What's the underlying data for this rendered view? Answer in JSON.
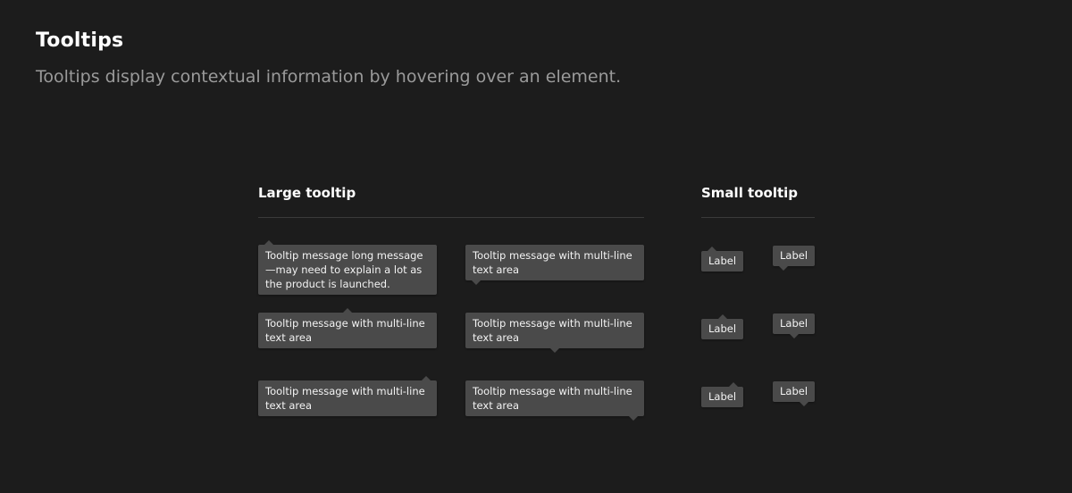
{
  "header": {
    "title": "Tooltips",
    "subtitle": "Tooltips display contextual information by hovering over an element."
  },
  "large": {
    "heading": "Large tooltip",
    "long_message": "Tooltip message long message—may need to explain a lot as the product is launched.",
    "message": "Tooltip message with multi-line text area"
  },
  "small": {
    "heading": "Small tooltip",
    "label": "Label"
  },
  "colors": {
    "background": "#1c1c1c",
    "tooltip": "#4a4a4a",
    "subtitle": "#9a9a9a",
    "divider": "#3a3a3a"
  }
}
